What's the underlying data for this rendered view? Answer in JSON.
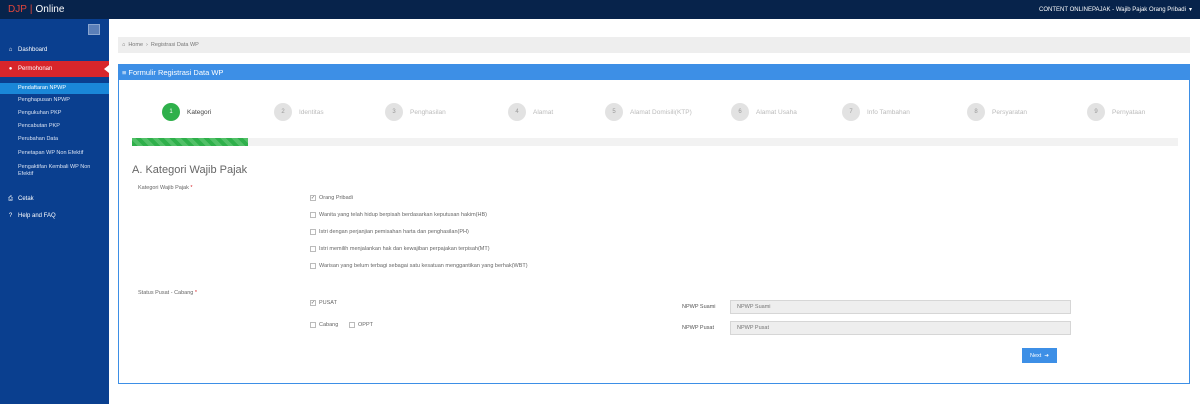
{
  "header": {
    "brand_left": "DJP",
    "brand_sep": "|",
    "brand_right": "Online",
    "user_label": "CONTENT ONLINEPAJAK - Wajib Pajak Orang Pribadi"
  },
  "sidebar": {
    "dashboard": "Dashboard",
    "permohonan": "Permohonan",
    "sub_items": [
      "Pendaftaran NPWP",
      "Penghapusan NPWP",
      "Pengukuhan PKP",
      "Pencabutan PKP",
      "Perubahan Data",
      "Penetapan WP Non Efektif",
      "Pengaktifan Kembali WP Non Efektif"
    ],
    "cetak": "Cetak",
    "help": "Help and FAQ"
  },
  "breadcrumb": {
    "home": "Home",
    "sep": "›",
    "current": "Registrasi Data WP"
  },
  "panel": {
    "title": "Formulir Registrasi Data WP"
  },
  "steps": [
    {
      "num": "1",
      "label": "Kategori"
    },
    {
      "num": "2",
      "label": "Identitas"
    },
    {
      "num": "3",
      "label": "Penghasilan"
    },
    {
      "num": "4",
      "label": "Alamat"
    },
    {
      "num": "5",
      "label": "Alamat Domisili(KTP)"
    },
    {
      "num": "6",
      "label": "Alamat Usaha"
    },
    {
      "num": "7",
      "label": "Info Tambahan"
    },
    {
      "num": "8",
      "label": "Persyaratan"
    },
    {
      "num": "9",
      "label": "Pernyataan"
    }
  ],
  "progress_fraction": 0.111,
  "form": {
    "section_title": "A. Kategori Wajib Pajak",
    "kategori_label": "Kategori Wajib Pajak",
    "required_mark": "*",
    "kategori_options": [
      {
        "label": "Orang Pribadi",
        "checked": true
      },
      {
        "label": "Wanita yang telah hidup berpisah berdasarkan keputusan hakim(HB)",
        "checked": false
      },
      {
        "label": "Istri dengan perjanjian pemisahan harta dan penghasilan(PH)",
        "checked": false
      },
      {
        "label": "Istri memilih menjalankan hak dan kewajiban perpajakan terpisah(MT)",
        "checked": false
      },
      {
        "label": "Warisan yang belum terbagi sebagai satu kesatuan menggantikan yang berhak(WBT)",
        "checked": false
      }
    ],
    "status_label": "Status Pusat - Cabang",
    "status_pusat": {
      "label": "PUSAT",
      "checked": true
    },
    "status_cabang": {
      "label": "Cabang",
      "checked": false
    },
    "status_oppt": {
      "label": "OPPT",
      "checked": false
    },
    "npwp_suami_label": "NPWP Suami",
    "npwp_suami_placeholder": "NPWP Suami",
    "npwp_pusat_label": "NPWP Pusat",
    "npwp_pusat_placeholder": "NPWP Pusat",
    "next_label": "Next",
    "check_mark": "✓"
  }
}
